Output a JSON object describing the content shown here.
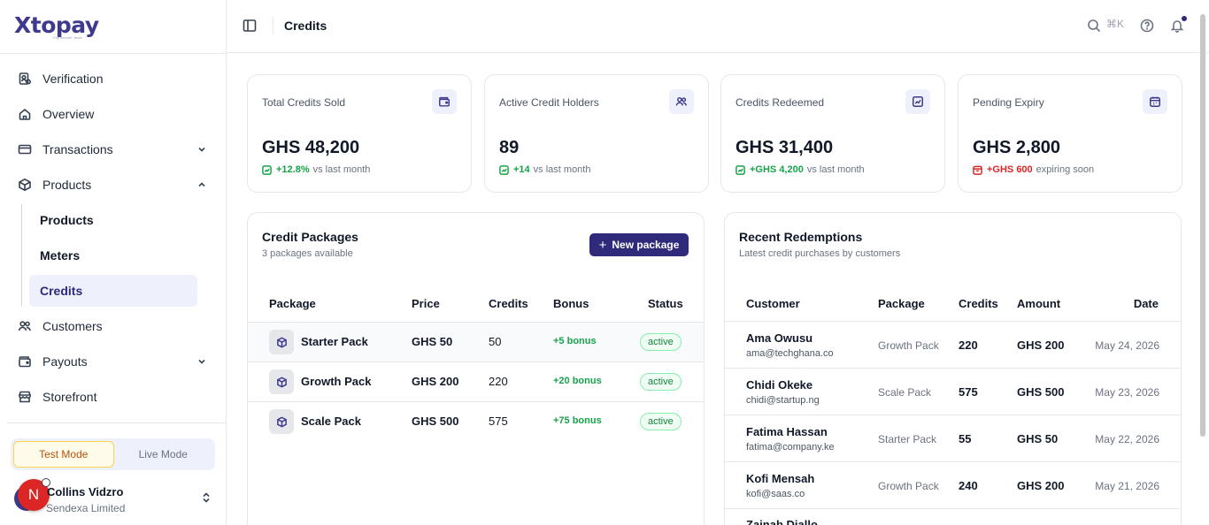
{
  "brand": {
    "name": "Xtopay",
    "tagline": "Pay smarter, faster"
  },
  "sidebar": {
    "items": [
      {
        "label": "Verification",
        "icon": "verification-icon"
      },
      {
        "label": "Overview",
        "icon": "home-icon"
      },
      {
        "label": "Transactions",
        "icon": "card-icon"
      },
      {
        "label": "Products",
        "icon": "box-icon"
      },
      {
        "label": "Customers",
        "icon": "users-icon"
      },
      {
        "label": "Payouts",
        "icon": "wallet-icon"
      },
      {
        "label": "Storefront",
        "icon": "store-icon"
      }
    ],
    "sub_items": [
      {
        "label": "Products"
      },
      {
        "label": "Meters"
      },
      {
        "label": "Credits"
      }
    ],
    "mode": {
      "test": "Test Mode",
      "live": "Live Mode",
      "selected": "Test Mode"
    },
    "user": {
      "initial": "N",
      "name": "Collins Vidzro",
      "org": "Sendexa Limited"
    }
  },
  "topbar": {
    "title": "Credits",
    "shortcut": "⌘K"
  },
  "stats": [
    {
      "label": "Total Credits Sold",
      "value": "GHS 48,200",
      "delta": "+12.8%",
      "note": "vs last month",
      "trend": "up",
      "icon": "wallet-icon"
    },
    {
      "label": "Active Credit Holders",
      "value": "89",
      "delta": "+14",
      "note": "vs last month",
      "trend": "up",
      "icon": "users-icon"
    },
    {
      "label": "Credits Redeemed",
      "value": "GHS 31,400",
      "delta": "+GHS 4,200",
      "note": "vs last month",
      "trend": "up",
      "icon": "chart-icon"
    },
    {
      "label": "Pending Expiry",
      "value": "GHS 2,800",
      "delta": "+GHS 600",
      "note": "expiring soon",
      "trend": "down",
      "icon": "calendar-icon"
    }
  ],
  "packages": {
    "title": "Credit Packages",
    "subtitle": "3 packages available",
    "new_button": "New package",
    "columns": [
      "Package",
      "Price",
      "Credits",
      "Bonus",
      "Status"
    ],
    "rows": [
      {
        "name": "Starter Pack",
        "price": "GHS 50",
        "credits": "50",
        "bonus": "+5 bonus",
        "status": "active"
      },
      {
        "name": "Growth Pack",
        "price": "GHS 200",
        "credits": "220",
        "bonus": "+20 bonus",
        "status": "active"
      },
      {
        "name": "Scale Pack",
        "price": "GHS 500",
        "credits": "575",
        "bonus": "+75 bonus",
        "status": "active"
      }
    ]
  },
  "redemptions": {
    "title": "Recent Redemptions",
    "subtitle": "Latest credit purchases by customers",
    "columns": [
      "Customer",
      "Package",
      "Credits",
      "Amount",
      "Date"
    ],
    "rows": [
      {
        "name": "Ama Owusu",
        "email": "ama@techghana.co",
        "package": "Growth Pack",
        "credits": "220",
        "amount": "GHS 200",
        "date": "May 24, 2026"
      },
      {
        "name": "Chidi Okeke",
        "email": "chidi@startup.ng",
        "package": "Scale Pack",
        "credits": "575",
        "amount": "GHS 500",
        "date": "May 23, 2026"
      },
      {
        "name": "Fatima Hassan",
        "email": "fatima@company.ke",
        "package": "Starter Pack",
        "credits": "55",
        "amount": "GHS 50",
        "date": "May 22, 2026"
      },
      {
        "name": "Kofi Mensah",
        "email": "kofi@saas.co",
        "package": "Growth Pack",
        "credits": "240",
        "amount": "GHS 200",
        "date": "May 21, 2026"
      },
      {
        "name": "Zainab Diallo",
        "email": "",
        "package": "",
        "credits": "",
        "amount": "",
        "date": ""
      }
    ]
  },
  "colors": {
    "brand": "#2f2a7a",
    "positive": "#16a34a",
    "negative": "#dc2626",
    "avatar": "#dc2626"
  }
}
